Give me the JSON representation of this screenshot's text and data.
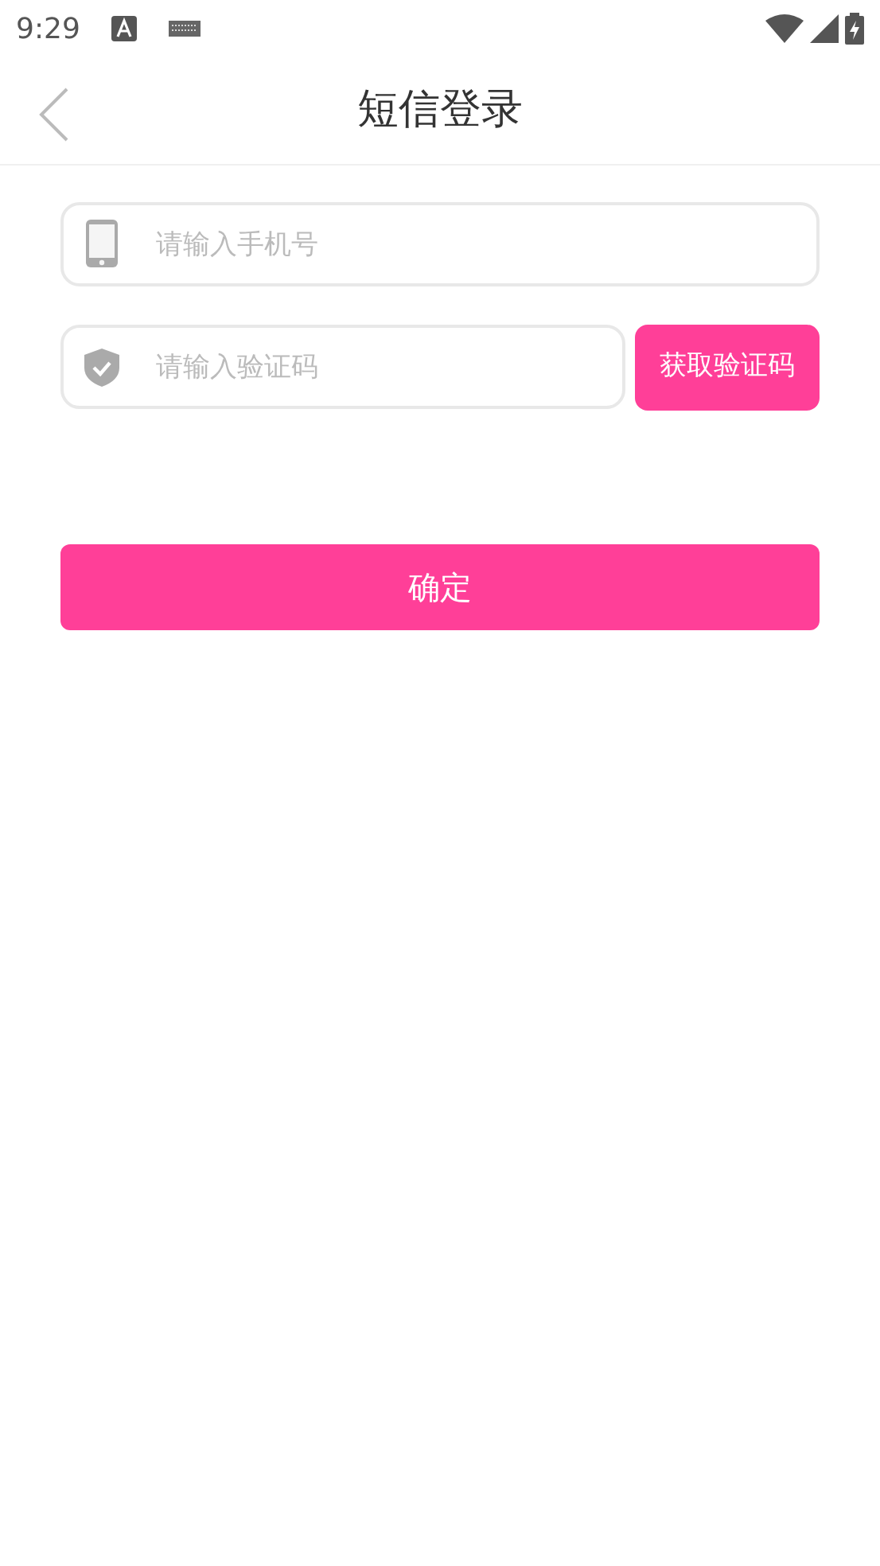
{
  "status_bar": {
    "time": "9:29"
  },
  "header": {
    "title": "短信登录"
  },
  "phone_field": {
    "placeholder": "请输入手机号"
  },
  "code_field": {
    "placeholder": "请输入验证码"
  },
  "get_code_button": {
    "label": "获取验证码"
  },
  "confirm_button": {
    "label": "确定"
  }
}
